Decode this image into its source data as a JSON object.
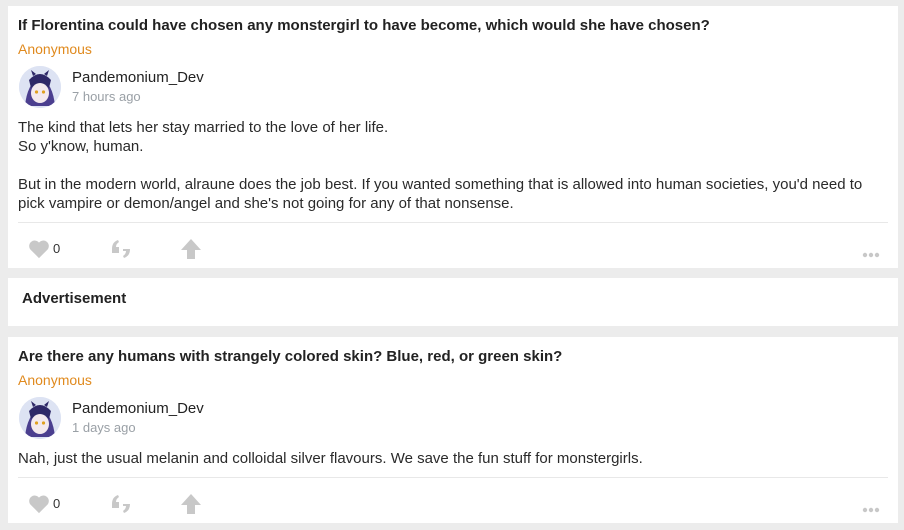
{
  "posts": [
    {
      "question": "If Florentina could have chosen any monstergirl to have become, which would she have chosen?",
      "asker": "Anonymous",
      "username": "Pandemonium_Dev",
      "time": "7 hours ago",
      "answer_lines": [
        "The kind that lets her stay married to the love of her life.",
        "So y'know, human.",
        "But in the modern world, alraune does the job best. If you wanted something that is allowed into human societies, you'd need to pick vampire or demon/angel and she's not going for any of that nonsense."
      ],
      "likes": "0"
    },
    {
      "question": "Are there any humans with strangely colored skin? Blue, red, or green skin?",
      "asker": "Anonymous",
      "username": "Pandemonium_Dev",
      "time": "1 days ago",
      "answer_lines": [
        "Nah, just the usual melanin and colloidal silver flavours. We save the fun stuff for monstergirls."
      ],
      "likes": "0"
    }
  ],
  "ad": {
    "label": "Advertisement"
  },
  "icons": {
    "like": "heart-icon",
    "quote": "quote-icon",
    "share": "arrow-up-icon",
    "more": "more-horizontal-icon",
    "avatar": "avatar-image"
  },
  "colors": {
    "asker": "#e08a1e",
    "icon": "#c8c8c8",
    "background": "#ececec",
    "card": "#ffffff"
  }
}
